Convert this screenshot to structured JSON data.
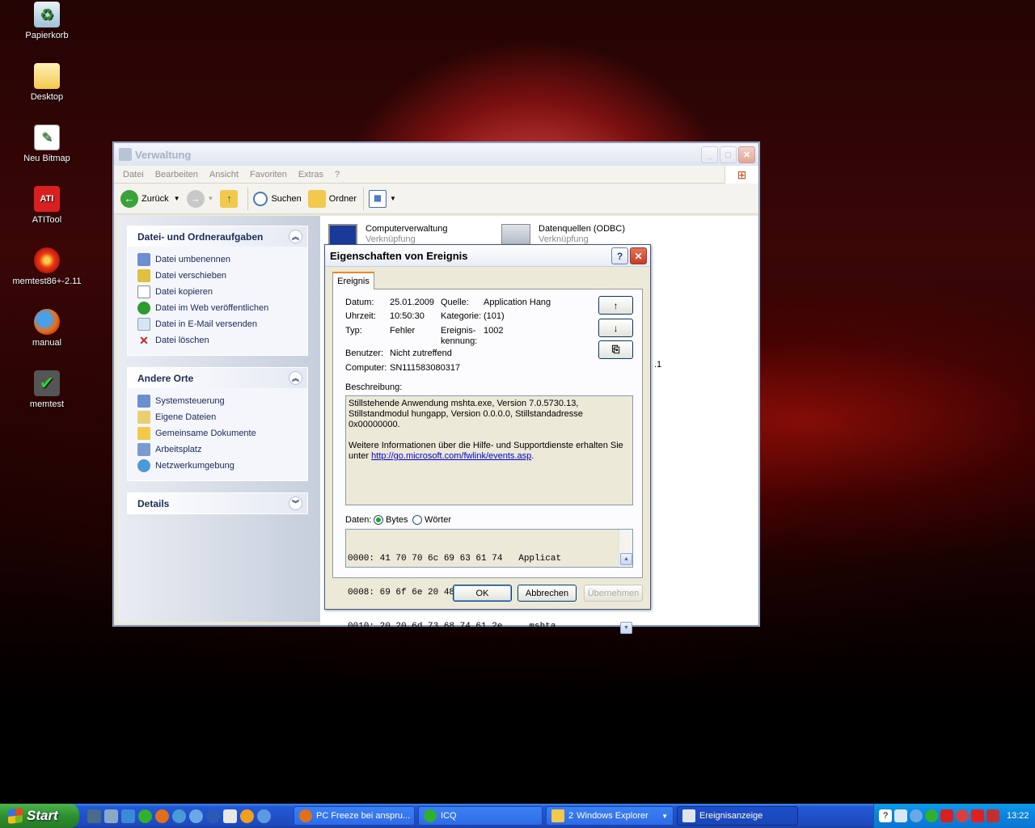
{
  "desktop": {
    "icons": [
      {
        "label": "Papierkorb"
      },
      {
        "label": "Desktop"
      },
      {
        "label": "Neu Bitmap"
      },
      {
        "label": "ATITool"
      },
      {
        "label": "memtest86+-2.11"
      },
      {
        "label": "manual"
      },
      {
        "label": "memtest"
      }
    ]
  },
  "explorer": {
    "title": "Verwaltung",
    "menu": [
      "Datei",
      "Bearbeiten",
      "Ansicht",
      "Favoriten",
      "Extras",
      "?"
    ],
    "toolbar": {
      "back": "Zurück",
      "search": "Suchen",
      "folders": "Ordner"
    },
    "tasks_panel": {
      "title": "Datei- und Ordneraufgaben",
      "items": [
        "Datei umbenennen",
        "Datei verschieben",
        "Datei kopieren",
        "Datei im Web veröffentlichen",
        "Datei in E-Mail versenden",
        "Datei löschen"
      ]
    },
    "places_panel": {
      "title": "Andere Orte",
      "items": [
        "Systemsteuerung",
        "Eigene Dateien",
        "Gemeinsame Dokumente",
        "Arbeitsplatz",
        "Netzwerkumgebung"
      ]
    },
    "details_panel": {
      "title": "Details"
    },
    "files": [
      {
        "name": "Computerverwaltung",
        "type": "Verknüpfung"
      },
      {
        "name": "Datenquellen (ODBC)",
        "type": "Verknüpfung"
      }
    ],
    "partial_text": ".1"
  },
  "dialog": {
    "title": "Eigenschaften von Ereignis",
    "help_btn": "?",
    "tab": "Ereignis",
    "fields": {
      "datum_label": "Datum:",
      "datum": "25.01.2009",
      "uhrzeit_label": "Uhrzeit:",
      "uhrzeit": "10:50:30",
      "typ_label": "Typ:",
      "typ": "Fehler",
      "benutzer_label": "Benutzer:",
      "benutzer": "Nicht zutreffend",
      "computer_label": "Computer:",
      "computer": "SN111583080317",
      "quelle_label": "Quelle:",
      "quelle": "Application Hang",
      "kategorie_label": "Kategorie:",
      "kategorie": "(101)",
      "kennung_label_1": "Ereignis-",
      "kennung_label_2": "kennung:",
      "kennung": "1002"
    },
    "beschreibung_label": "Beschreibung:",
    "beschreibung_line1": "Stillstehende Anwendung mshta.exe, Version 7.0.5730.13, Stillstandmodul hungapp, Version 0.0.0.0, Stillstandadresse 0x00000000.",
    "beschreibung_line2": "Weitere Informationen über die Hilfe- und Supportdienste erhalten Sie unter ",
    "beschreibung_link": "http://go.microsoft.com/fwlink/events.asp",
    "beschreibung_end": ".",
    "daten_label": "Daten:",
    "radio_bytes": "Bytes",
    "radio_words": "Wörter",
    "hex_lines": [
      "0000: 41 70 70 6c 69 63 61 74   Applicat",
      "0008: 69 6f 6e 20 48 61 6e 67   ion Hang",
      "0010: 20 20 6d 73 68 74 61 2e     mshta."
    ],
    "buttons": {
      "ok": "OK",
      "cancel": "Abbrechen",
      "apply": "Übernehmen"
    }
  },
  "taskbar": {
    "start": "Start",
    "tasks": [
      {
        "label": "PC Freeze bei anspru..."
      },
      {
        "label": "ICQ"
      },
      {
        "count": "2",
        "label": "Windows Explorer"
      },
      {
        "label": "Ereignisanzeige"
      }
    ],
    "clock": "13:22"
  }
}
